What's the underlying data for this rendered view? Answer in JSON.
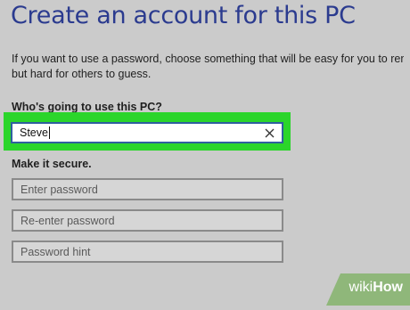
{
  "header": {
    "title": "Create an account for this PC"
  },
  "intro": {
    "line1": "If you want to use a password, choose something that will be easy for you to remembe",
    "line2": "but hard for others to guess."
  },
  "who": {
    "label": "Who's going to use this PC?",
    "value": "Steve",
    "clear_icon": "close-icon"
  },
  "secure": {
    "label": "Make it secure.",
    "password_placeholder": "Enter password",
    "reenter_placeholder": "Re-enter password",
    "hint_placeholder": "Password hint"
  },
  "watermark": {
    "wiki": "wiki",
    "how": "How"
  },
  "colors": {
    "title": "#2b3b8f",
    "highlight": "#2bd52b",
    "field_focus_border": "#2f5f9e",
    "background": "#cbcbcb",
    "watermark_bg": "#8fb77a"
  }
}
